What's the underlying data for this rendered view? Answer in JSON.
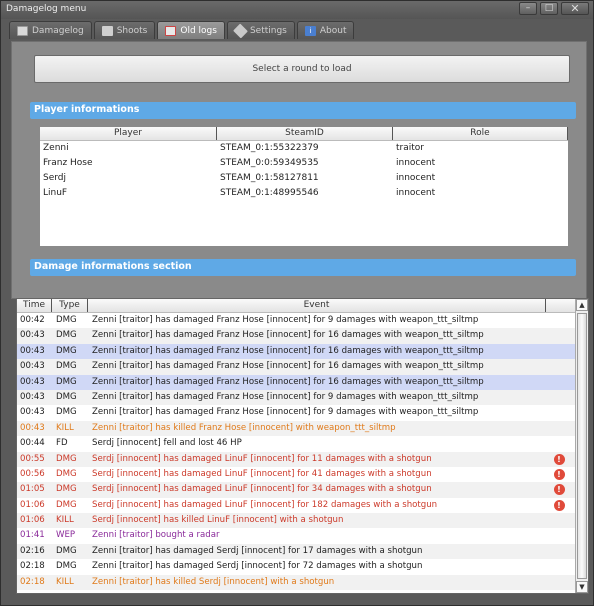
{
  "window": {
    "title": "Damagelog menu",
    "minimize": "–",
    "maximize": "□",
    "close": "✕"
  },
  "tabs": [
    {
      "label": "Damagelog",
      "icon": "log-icon",
      "active": false
    },
    {
      "label": "Shoots",
      "icon": "shoot-icon",
      "active": false
    },
    {
      "label": "Old logs",
      "icon": "old-logs-icon",
      "active": true
    },
    {
      "label": "Settings",
      "icon": "settings-icon",
      "active": false
    },
    {
      "label": "About",
      "icon": "about-icon",
      "active": false
    }
  ],
  "load_button": "Select a round to load",
  "player_section": {
    "title": "Player informations",
    "columns": [
      "Player",
      "SteamID",
      "Role"
    ],
    "rows": [
      [
        "Zenni",
        "STEAM_0:1:55322379",
        "traitor"
      ],
      [
        "Franz Hose",
        "STEAM_0:0:59349535",
        "innocent"
      ],
      [
        "Serdj",
        "STEAM_0:1:58127811",
        "innocent"
      ],
      [
        "LinuF",
        "STEAM_0:1:48995546",
        "innocent"
      ]
    ]
  },
  "damage_section": {
    "title": "Damage informations section"
  },
  "log": {
    "columns": [
      "Time",
      "Type",
      "Event"
    ],
    "rows": [
      {
        "time": "00:42",
        "type": "DMG",
        "event": "Zenni [traitor] has damaged Franz Hose [innocent] for 9 damages with weapon_ttt_siltmp",
        "color": "#222222",
        "sel": false,
        "warn": false
      },
      {
        "time": "00:43",
        "type": "DMG",
        "event": "Zenni [traitor] has damaged Franz Hose [innocent] for 16 damages with weapon_ttt_siltmp",
        "color": "#222222",
        "sel": false,
        "warn": false
      },
      {
        "time": "00:43",
        "type": "DMG",
        "event": "Zenni [traitor] has damaged Franz Hose [innocent] for 16 damages with weapon_ttt_siltmp",
        "color": "#222222",
        "sel": true,
        "warn": false
      },
      {
        "time": "00:43",
        "type": "DMG",
        "event": "Zenni [traitor] has damaged Franz Hose [innocent] for 16 damages with weapon_ttt_siltmp",
        "color": "#222222",
        "sel": false,
        "warn": false
      },
      {
        "time": "00:43",
        "type": "DMG",
        "event": "Zenni [traitor] has damaged Franz Hose [innocent] for 16 damages with weapon_ttt_siltmp",
        "color": "#222222",
        "sel": true,
        "warn": false
      },
      {
        "time": "00:43",
        "type": "DMG",
        "event": "Zenni [traitor] has damaged Franz Hose [innocent] for 9 damages with weapon_ttt_siltmp",
        "color": "#222222",
        "sel": false,
        "warn": false
      },
      {
        "time": "00:43",
        "type": "DMG",
        "event": "Zenni [traitor] has damaged Franz Hose [innocent] for 9 damages with weapon_ttt_siltmp",
        "color": "#222222",
        "sel": false,
        "warn": false
      },
      {
        "time": "00:43",
        "type": "KILL",
        "event": "Zenni [traitor] has killed Franz Hose [innocent] with weapon_ttt_siltmp",
        "color": "#e07a1a",
        "sel": false,
        "warn": false
      },
      {
        "time": "00:44",
        "type": "FD",
        "event": "Serdj [innocent] fell and lost 46 HP",
        "color": "#222222",
        "sel": false,
        "warn": false
      },
      {
        "time": "00:55",
        "type": "DMG",
        "event": "Serdj [innocent] has damaged LinuF [innocent] for 11 damages with a shotgun",
        "color": "#cc3a2a",
        "sel": false,
        "warn": true
      },
      {
        "time": "00:56",
        "type": "DMG",
        "event": "Serdj [innocent] has damaged LinuF [innocent] for 41 damages with a shotgun",
        "color": "#cc3a2a",
        "sel": false,
        "warn": true
      },
      {
        "time": "01:05",
        "type": "DMG",
        "event": "Serdj [innocent] has damaged LinuF [innocent] for 34 damages with a shotgun",
        "color": "#cc3a2a",
        "sel": false,
        "warn": true
      },
      {
        "time": "01:06",
        "type": "DMG",
        "event": "Serdj [innocent] has damaged LinuF [innocent] for 182 damages with a shotgun",
        "color": "#cc3a2a",
        "sel": false,
        "warn": true
      },
      {
        "time": "01:06",
        "type": "KILL",
        "event": "Serdj [innocent] has killed LinuF [innocent] with a shotgun",
        "color": "#cc3a2a",
        "sel": false,
        "warn": false
      },
      {
        "time": "01:41",
        "type": "WEP",
        "event": "Zenni [traitor] bought a radar",
        "color": "#8a2a9a",
        "sel": false,
        "warn": false
      },
      {
        "time": "02:16",
        "type": "DMG",
        "event": "Zenni [traitor] has damaged Serdj [innocent] for 17 damages with a shotgun",
        "color": "#222222",
        "sel": false,
        "warn": false
      },
      {
        "time": "02:18",
        "type": "DMG",
        "event": "Zenni [traitor] has damaged Serdj [innocent] for 72 damages with a shotgun",
        "color": "#222222",
        "sel": false,
        "warn": false
      },
      {
        "time": "02:18",
        "type": "KILL",
        "event": "Zenni [traitor] has killed Serdj [innocent] with a shotgun",
        "color": "#e07a1a",
        "sel": false,
        "warn": false
      }
    ]
  }
}
